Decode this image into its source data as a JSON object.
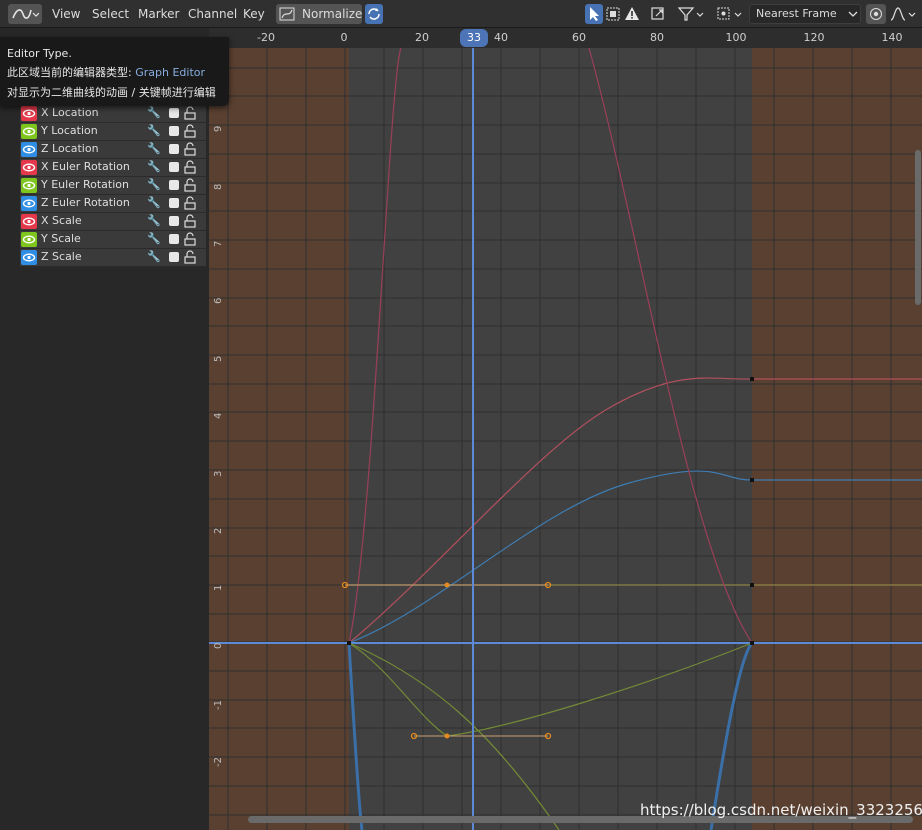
{
  "header": {
    "menus": [
      "View",
      "Select",
      "Marker",
      "Channel",
      "Key"
    ],
    "normalize_label": "Normalize",
    "snap_label": "Nearest Frame",
    "editor_type_icon": "graph-editor-icon"
  },
  "tooltip": {
    "title": "Editor Type.",
    "line2_prefix": "此区域当前的编辑器类型:",
    "line2_value": "Graph Editor",
    "line3": "对显示为二维曲线的动画 / 关键帧进行编辑"
  },
  "channels": [
    {
      "label": "X Location",
      "color": "#e5384a"
    },
    {
      "label": "Y Location",
      "color": "#7ec51d"
    },
    {
      "label": "Z Location",
      "color": "#2f8de4"
    },
    {
      "label": "X Euler Rotation",
      "color": "#e5384a"
    },
    {
      "label": "Y Euler Rotation",
      "color": "#7ec51d"
    },
    {
      "label": "Z Euler Rotation",
      "color": "#2f8de4"
    },
    {
      "label": "X Scale",
      "color": "#e5384a"
    },
    {
      "label": "Y Scale",
      "color": "#7ec51d"
    },
    {
      "label": "Z Scale",
      "color": "#2f8de4"
    }
  ],
  "timeline": {
    "ticks": [
      "-20",
      "0",
      "20",
      "40",
      "60",
      "80",
      "100",
      "120",
      "140"
    ],
    "current_frame": "33",
    "y_ticks": [
      "9",
      "8",
      "7",
      "6",
      "5",
      "4",
      "3",
      "2",
      "1",
      "0",
      "-1",
      "-2"
    ]
  },
  "watermark": "https://blog.csdn.net/weixin_33232568",
  "colors": {
    "out_of_range": "#5a4030",
    "in_range": "#414141",
    "cursor": "#5d8ad6",
    "key_handle": "#e48a1f"
  }
}
